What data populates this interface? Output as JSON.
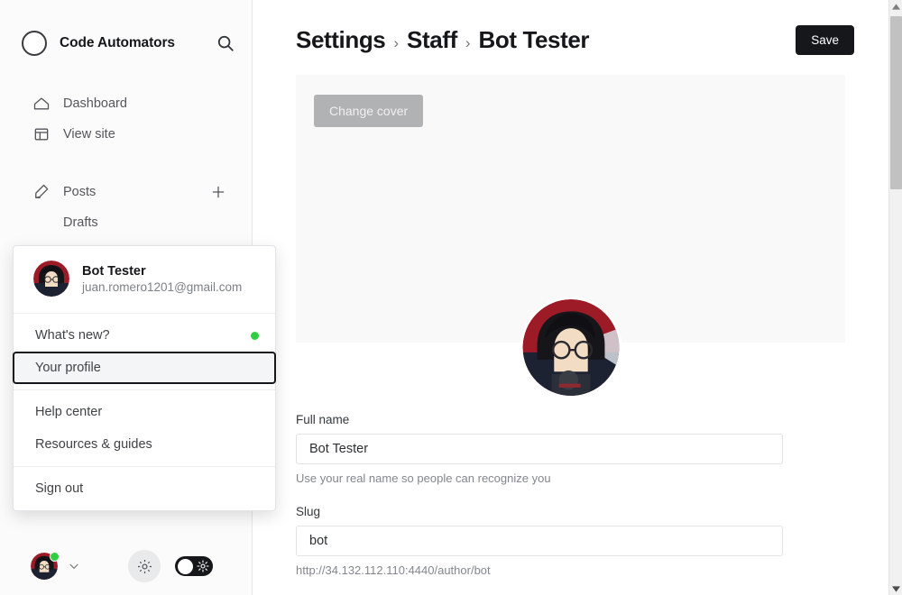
{
  "sidebar": {
    "brand": {
      "title": "Code Automators",
      "logo_icon": "ring-logo",
      "search_icon": "search-icon"
    },
    "items": [
      {
        "label": "Dashboard",
        "icon": "home-icon",
        "type": "link"
      },
      {
        "label": "View site",
        "icon": "layout-icon",
        "type": "link"
      },
      {
        "label": "Posts",
        "icon": "edit-icon",
        "type": "section",
        "add_icon": "plus-icon"
      },
      {
        "label": "Drafts",
        "icon": "",
        "type": "sub"
      }
    ],
    "footer": {
      "avatar_name": "user-avatar",
      "status": "online",
      "chevron_icon": "chevron-down-icon",
      "gear_icon": "gear-icon",
      "theme_toggle_icon": "sun-icon",
      "theme_toggle_state": "off"
    }
  },
  "user_menu": {
    "name": "Bot Tester",
    "email": "juan.romero1201@gmail.com",
    "avatar_name": "user-avatar",
    "groups": [
      [
        {
          "label": "What's new?",
          "badge": "dot",
          "focused": false
        },
        {
          "label": "Your profile",
          "badge": "",
          "focused": true
        }
      ],
      [
        {
          "label": "Help center",
          "badge": "",
          "focused": false
        },
        {
          "label": "Resources & guides",
          "badge": "",
          "focused": false
        }
      ],
      [
        {
          "label": "Sign out",
          "badge": "",
          "focused": false
        }
      ]
    ]
  },
  "main": {
    "breadcrumb": [
      "Settings",
      "Staff",
      "Bot Tester"
    ],
    "breadcrumb_separator": "›",
    "save_label": "Save",
    "cover": {
      "change_label": "Change cover",
      "avatar_name": "profile-avatar"
    },
    "fields": [
      {
        "label": "Full name",
        "value": "Bot Tester",
        "placeholder": "Full name",
        "hint": "Use your real name so people can recognize you"
      },
      {
        "label": "Slug",
        "value": "bot",
        "placeholder": "Slug",
        "hint": "http://34.132.112.110:4440/author/bot"
      }
    ]
  },
  "scrollbar": {
    "up_icon": "caret-up-icon",
    "down_icon": "caret-down-icon"
  },
  "colors": {
    "accent_dark": "#15171a",
    "status_green": "#30cf43",
    "sidebar_bg": "#fbfbfb",
    "cover_bg": "#f9f9fa",
    "border": "#e0e2e6"
  }
}
